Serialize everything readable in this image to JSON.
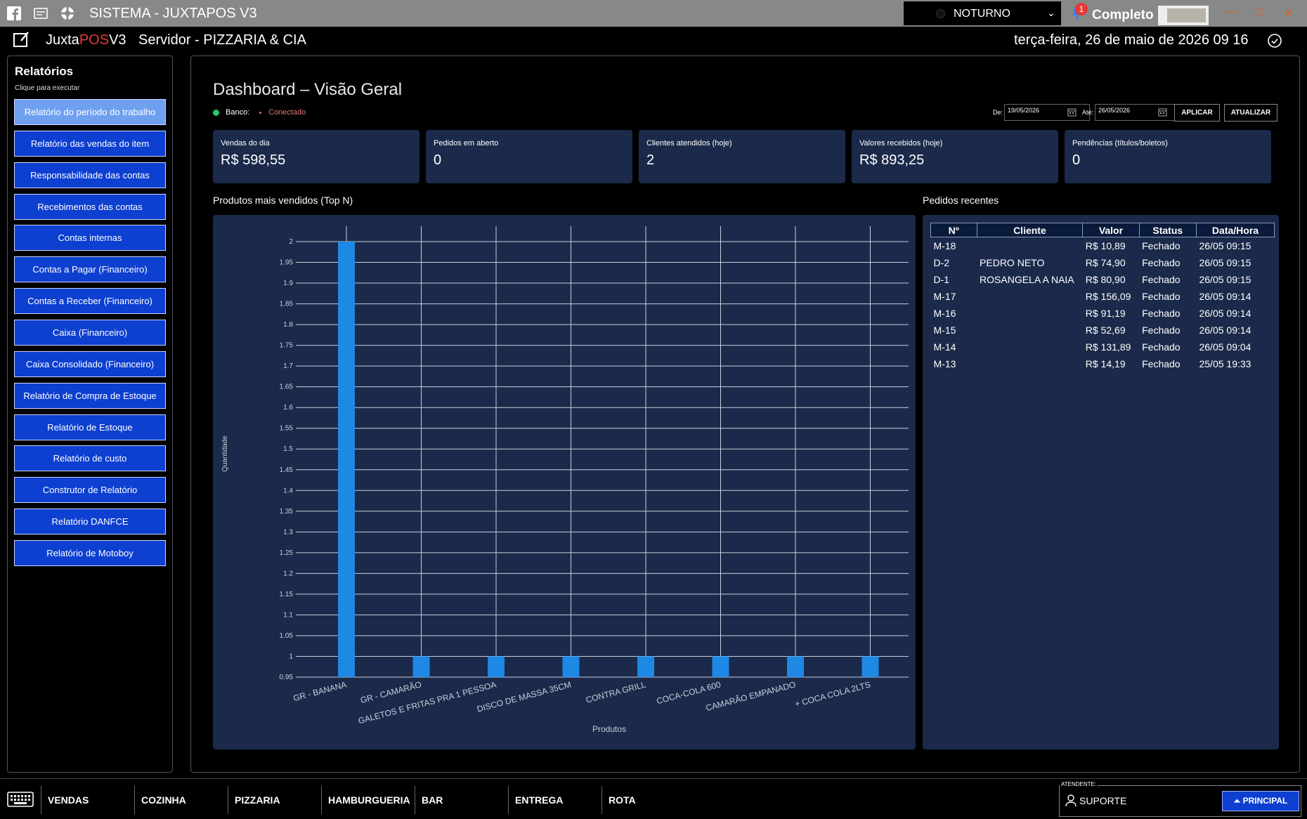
{
  "titlebar": {
    "title": "SISTEMA - JUXTAPOS V3",
    "shift": "NOTURNO",
    "notification_count": "1",
    "mode_label": "Completo"
  },
  "header": {
    "brand_prefix": "Juxta",
    "brand_pos": "POS",
    "brand_suffix": "V3",
    "server": "Servidor - PIZZARIA & CIA",
    "datetime": "terça-feira, 26 de maio de 2026 09 16"
  },
  "reports": {
    "title": "Relatórios",
    "subtitle": "Clique para executar",
    "items": [
      "Relatório do período do trabalho",
      "Relatório das vendas do item",
      "Responsabilidade das contas",
      "Recebimentos das contas",
      "Contas internas",
      "Contas a Pagar (Financeiro)",
      "Contas a Receber (Financeiro)",
      "Caixa (Financeiro)",
      "Caixa Consolidado (Financeiro)",
      "Relatório de Compra de Estoque",
      "Relatório de Estoque",
      "Relatório de custo",
      "Construtor de Relatório",
      "Relatório DANFCE",
      "Relatório de Motoboy"
    ]
  },
  "dashboard": {
    "title": "Dashboard – Visão Geral",
    "db_label": "Banco:",
    "db_status": "Conectado",
    "from_label": "De:",
    "from_date": "19/05/2026",
    "to_label": "Até:",
    "to_date": "26/05/2026",
    "apply_label": "APLICAR",
    "refresh_label": "ATUALIZAR"
  },
  "kpis": [
    {
      "label": "Vendas do dia",
      "value": "R$ 598,55"
    },
    {
      "label": "Pedidos em aberto",
      "value": "0"
    },
    {
      "label": "Clientes atendidos (hoje)",
      "value": "2"
    },
    {
      "label": "Valores recebidos (hoje)",
      "value": "R$ 893,25"
    },
    {
      "label": "Pendências (títulos/boletos)",
      "value": "0"
    }
  ],
  "chart_section_title": "Produtos mais vendidos (Top N)",
  "chart_data": {
    "type": "bar",
    "categories": [
      "GR - BANANA",
      "GR - CAMARÃO",
      "GALETOS E FRITAS PRA 1 PESSOA",
      "DISCO DE MASSA 35CM",
      "CONTRA GRILL",
      "COCA-COLA 600",
      "CAMARÃO EMPANADO",
      "+ COCA COLA 2LTS"
    ],
    "values": [
      2,
      1,
      1,
      1,
      1,
      1,
      1,
      1
    ],
    "xlabel": "Produtos",
    "ylabel": "Quantidade",
    "ylim": [
      0.95,
      2
    ],
    "yticks": [
      "0.95",
      "1",
      "1.05",
      "1.1",
      "1.15",
      "1.2",
      "1.25",
      "1.3",
      "1.35",
      "1.4",
      "1.45",
      "1.5",
      "1.55",
      "1.6",
      "1.65",
      "1.7",
      "1.75",
      "1.8",
      "1.85",
      "1.9",
      "1.95",
      "2"
    ],
    "grid": true,
    "color": "#1e88e5"
  },
  "orders": {
    "title": "Pedidos recentes",
    "columns": [
      "Nº",
      "Cliente",
      "Valor",
      "Status",
      "Data/Hora"
    ],
    "rows": [
      [
        "M-18",
        "",
        "R$ 10,89",
        "Fechado",
        "26/05 09:15"
      ],
      [
        "D-2",
        "PEDRO NETO",
        "R$ 74,90",
        "Fechado",
        "26/05 09:15"
      ],
      [
        "D-1",
        "ROSANGELA A NAIA",
        "R$ 80,90",
        "Fechado",
        "26/05 09:15"
      ],
      [
        "M-17",
        "",
        "R$ 156,09",
        "Fechado",
        "26/05 09:14"
      ],
      [
        "M-16",
        "",
        "R$ 91,19",
        "Fechado",
        "26/05 09:14"
      ],
      [
        "M-15",
        "",
        "R$ 52,69",
        "Fechado",
        "26/05 09:14"
      ],
      [
        "M-14",
        "",
        "R$ 131,89",
        "Fechado",
        "26/05 09:04"
      ],
      [
        "M-13",
        "",
        "R$ 14,19",
        "Fechado",
        "25/05 19:33"
      ]
    ]
  },
  "bottom_nav": [
    "VENDAS",
    "COZINHA",
    "PIZZARIA",
    "HAMBURGUERIA",
    "BAR",
    "ENTREGA",
    "ROTA"
  ],
  "attendant": {
    "label": "ATENDENTE:",
    "user": "SUPORTE",
    "principal_label": "PRINCIPAL"
  }
}
